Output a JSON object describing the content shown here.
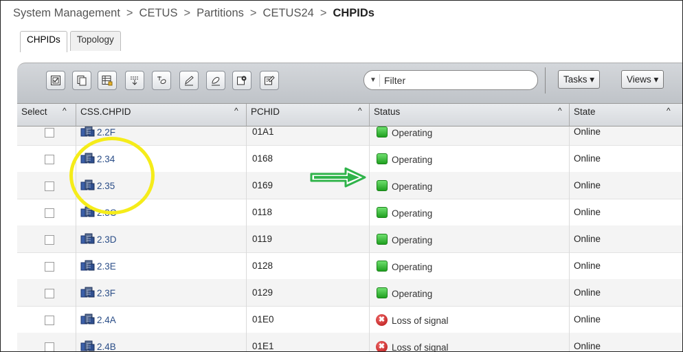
{
  "breadcrumb": {
    "items": [
      "System Management",
      "CETUS",
      "Partitions",
      "CETUS24"
    ],
    "separator": ">",
    "current": "CHPIDs"
  },
  "tabs": [
    {
      "label": "CHPIDs",
      "active": true
    },
    {
      "label": "Topology",
      "active": false
    }
  ],
  "toolbar": {
    "buttons": [
      "select-all-icon",
      "copy-icon",
      "table-config-icon",
      "sort-icon",
      "clear-filter-icon",
      "edit-icon",
      "erase-icon",
      "settings-icon",
      "details-icon"
    ],
    "filter_placeholder": "Filter",
    "tasks_label": "Tasks ▾",
    "views_label": "Views ▾"
  },
  "grid": {
    "columns": [
      {
        "label": "Select",
        "caret": "^"
      },
      {
        "label": "CSS.CHPID",
        "caret": "^"
      },
      {
        "label": "PCHID",
        "caret": "^"
      },
      {
        "label": "Status",
        "caret": "^"
      },
      {
        "label": "State",
        "caret": "^"
      }
    ],
    "rows": [
      {
        "chpid": "2.2F",
        "pchid": "01A1",
        "status": "Operating",
        "status_kind": "ok",
        "state": "Online"
      },
      {
        "chpid": "2.34",
        "pchid": "0168",
        "status": "Operating",
        "status_kind": "ok",
        "state": "Online"
      },
      {
        "chpid": "2.35",
        "pchid": "0169",
        "status": "Operating",
        "status_kind": "ok",
        "state": "Online"
      },
      {
        "chpid": "2.3C",
        "pchid": "0118",
        "status": "Operating",
        "status_kind": "ok",
        "state": "Online"
      },
      {
        "chpid": "2.3D",
        "pchid": "0119",
        "status": "Operating",
        "status_kind": "ok",
        "state": "Online"
      },
      {
        "chpid": "2.3E",
        "pchid": "0128",
        "status": "Operating",
        "status_kind": "ok",
        "state": "Online"
      },
      {
        "chpid": "2.3F",
        "pchid": "0129",
        "status": "Operating",
        "status_kind": "ok",
        "state": "Online"
      },
      {
        "chpid": "2.4A",
        "pchid": "01E0",
        "status": "Loss of signal",
        "status_kind": "error",
        "state": "Online"
      },
      {
        "chpid": "2.4B",
        "pchid": "01E1",
        "status": "Loss of signal",
        "status_kind": "error",
        "state": "Online"
      }
    ]
  },
  "colors": {
    "highlight_circle": "#f5ec1a",
    "annotation_arrow": "#2fb34a",
    "chpid_link": "#2a4d87",
    "status_ok": "#20a020",
    "status_error": "#c41a1a"
  }
}
